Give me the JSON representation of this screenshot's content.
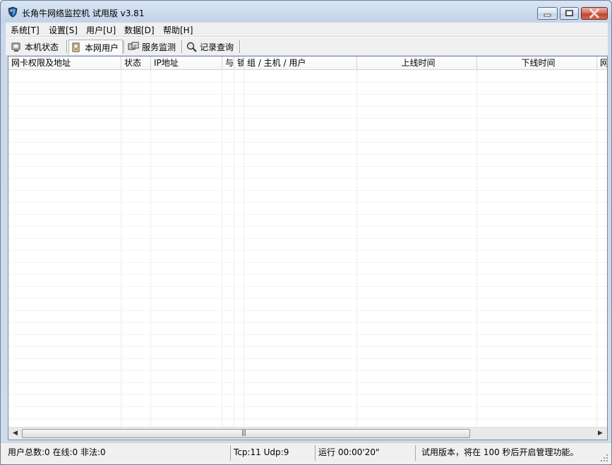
{
  "window": {
    "title": "长角牛网络监控机 试用版 v3.81"
  },
  "menu": [
    {
      "label": "系统[T]"
    },
    {
      "label": "设置[S]"
    },
    {
      "label": "用户[U]"
    },
    {
      "label": "数据[D]"
    },
    {
      "label": "帮助[H]"
    }
  ],
  "tabs": [
    {
      "label": "本机状态",
      "icon": "computer-status-icon"
    },
    {
      "label": "本网用户",
      "icon": "network-users-icon",
      "active": true
    },
    {
      "label": "服务监测",
      "icon": "service-monitor-icon"
    },
    {
      "label": "记录查询",
      "icon": "record-query-icon"
    }
  ],
  "table": {
    "columns": [
      {
        "label": "网卡权限及地址"
      },
      {
        "label": "状态"
      },
      {
        "label": "IP地址"
      },
      {
        "label": "与"
      },
      {
        "label": "锁"
      },
      {
        "label": "组 / 主机 / 用户"
      },
      {
        "label": "上线时间"
      },
      {
        "label": "下线时间"
      },
      {
        "label": "网"
      }
    ],
    "rows": []
  },
  "statusbar": {
    "users": "用户总数:0 在线:0 非法:0",
    "connections": "Tcp:11 Udp:9",
    "runtime": "运行 00:00'20\"",
    "notice": "试用版本，将在 100 秒后开启管理功能。"
  },
  "colors": {
    "titlebar": "#c8d8eb",
    "close_button": "#c4432c",
    "list_background": "#ffffff",
    "menubar": "#f0f0f0"
  }
}
